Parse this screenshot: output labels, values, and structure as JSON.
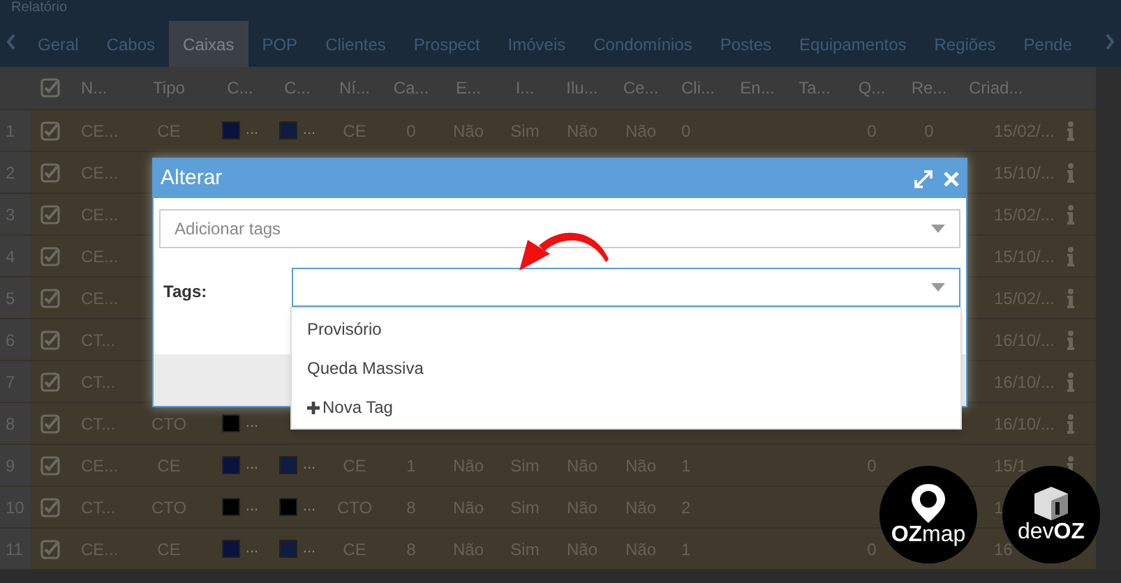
{
  "window": {
    "title": "Relatório"
  },
  "tabs": [
    {
      "label": "Geral",
      "selected": false
    },
    {
      "label": "Cabos",
      "selected": false
    },
    {
      "label": "Caixas",
      "selected": true
    },
    {
      "label": "POP",
      "selected": false
    },
    {
      "label": "Clientes",
      "selected": false
    },
    {
      "label": "Prospect",
      "selected": false
    },
    {
      "label": "Imóveis",
      "selected": false
    },
    {
      "label": "Condomínios",
      "selected": false
    },
    {
      "label": "Postes",
      "selected": false
    },
    {
      "label": "Equipamentos",
      "selected": false
    },
    {
      "label": "Regiões",
      "selected": false
    },
    {
      "label": "Pende",
      "selected": false
    }
  ],
  "table": {
    "header_checked": true,
    "columns": [
      "N...",
      "Tipo",
      "C...",
      "C...",
      "Ní...",
      "Ca...",
      "E...",
      "I...",
      "Ilu...",
      "Ce...",
      "Cli...",
      "En...",
      "Ta...",
      "Q...",
      "Re...",
      "Criad..."
    ],
    "rows": [
      {
        "number": "1",
        "checked": true,
        "cells": [
          "CE...",
          "CE",
          {
            "color": "#0a1240",
            "text": "..."
          },
          {
            "color": "#121c40",
            "text": "..."
          },
          "CE",
          "0",
          "Não",
          "Sim",
          "Não",
          "Não",
          "0",
          "",
          "",
          "0",
          "0",
          "15/02/..."
        ]
      },
      {
        "number": "2",
        "checked": true,
        "cells": [
          "CE...",
          "",
          "",
          "",
          "",
          "",
          "",
          "",
          "",
          "",
          "",
          "",
          "",
          "",
          "",
          "15/10/..."
        ]
      },
      {
        "number": "3",
        "checked": true,
        "cells": [
          "CE...",
          "",
          "",
          "",
          "",
          "",
          "",
          "",
          "",
          "",
          "",
          "",
          "",
          "",
          "",
          "15/02/..."
        ]
      },
      {
        "number": "4",
        "checked": true,
        "cells": [
          "CE...",
          "",
          "",
          "",
          "",
          "",
          "",
          "",
          "",
          "",
          "",
          "",
          "",
          "",
          "",
          "15/10/..."
        ]
      },
      {
        "number": "5",
        "checked": true,
        "cells": [
          "CE...",
          "",
          "",
          "",
          "",
          "",
          "",
          "",
          "",
          "",
          "",
          "",
          "",
          "",
          "",
          "15/02/..."
        ]
      },
      {
        "number": "6",
        "checked": true,
        "cells": [
          "CT...",
          "",
          "",
          "",
          "",
          "",
          "",
          "",
          "",
          "",
          "",
          "",
          "",
          "",
          "",
          "16/10/..."
        ]
      },
      {
        "number": "7",
        "checked": true,
        "cells": [
          "CT...",
          "",
          "",
          "",
          "",
          "",
          "",
          "",
          "",
          "",
          "",
          "",
          "",
          "",
          "",
          "16/10/..."
        ]
      },
      {
        "number": "8",
        "checked": true,
        "cells": [
          "CT...",
          "CTO",
          {
            "color": "#000000",
            "text": "..."
          },
          "",
          "",
          "",
          "",
          "",
          "",
          "",
          "",
          "",
          "",
          "",
          "",
          "16/10/..."
        ]
      },
      {
        "number": "9",
        "checked": true,
        "cells": [
          "CE...",
          "CE",
          {
            "color": "#0a1240",
            "text": "..."
          },
          {
            "color": "#121c40",
            "text": "..."
          },
          "CE",
          "1",
          "Não",
          "Sim",
          "Não",
          "Não",
          "1",
          "",
          "",
          "0",
          "",
          "15/1"
        ]
      },
      {
        "number": "10",
        "checked": true,
        "cells": [
          "CT...",
          "CTO",
          {
            "color": "#000000",
            "text": "..."
          },
          {
            "color": "#000000",
            "text": "..."
          },
          "CTO",
          "8",
          "Não",
          "Sim",
          "Não",
          "Não",
          "2",
          "",
          "",
          "",
          "",
          "1"
        ]
      },
      {
        "number": "11",
        "checked": true,
        "cells": [
          "CE...",
          "CE",
          {
            "color": "#0a1240",
            "text": "..."
          },
          {
            "color": "#121c40",
            "text": "..."
          },
          "CE",
          "8",
          "Não",
          "Sim",
          "Não",
          "Não",
          "1",
          "",
          "",
          "0",
          "",
          "16"
        ]
      }
    ]
  },
  "dialog": {
    "title": "Alterar",
    "tag_select": {
      "placeholder": "Adicionar tags"
    },
    "tags_field": {
      "label": "Tags:"
    },
    "options": [
      {
        "label": "Provisório",
        "kind": "option"
      },
      {
        "label": "Queda Massiva",
        "kind": "option"
      },
      {
        "label": "Nova Tag",
        "kind": "create"
      }
    ]
  },
  "logos": [
    {
      "text": "**OZ**map",
      "kind": "pin"
    },
    {
      "text": "dev**OZ**",
      "kind": "box"
    }
  ]
}
